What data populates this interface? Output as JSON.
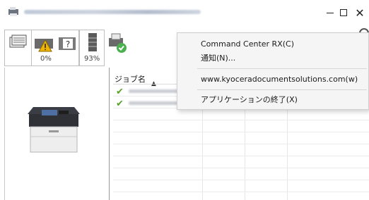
{
  "window": {
    "minimize_glyph": "–",
    "close_glyph": "✕"
  },
  "toolbar": {
    "toner_percent": "0%",
    "paper_percent": "93%",
    "collapse_glyph": "▲"
  },
  "job_list": {
    "column_name": "ジョブ名",
    "rows": [
      {
        "status": "✔"
      },
      {
        "status": "✔"
      }
    ]
  },
  "context_menu": {
    "items": [
      {
        "label": "Command Center RX(C)"
      },
      {
        "label": "通知(N)..."
      },
      {
        "label": "www.kyoceradocumentsolutions.com(w)"
      },
      {
        "label": "アプリケーションの終了(X)"
      }
    ]
  },
  "icons": [
    "app-icon",
    "printer-list-icon",
    "toner-warning-icon",
    "unknown-status-icon",
    "paper-tray-icon",
    "job-status-icon",
    "gear-icon",
    "printer-icon",
    "check-icon"
  ],
  "colors": {
    "check_green": "#5aa02c",
    "warning_yellow": "#f0b400",
    "menu_bg": "#f5f5f5"
  }
}
